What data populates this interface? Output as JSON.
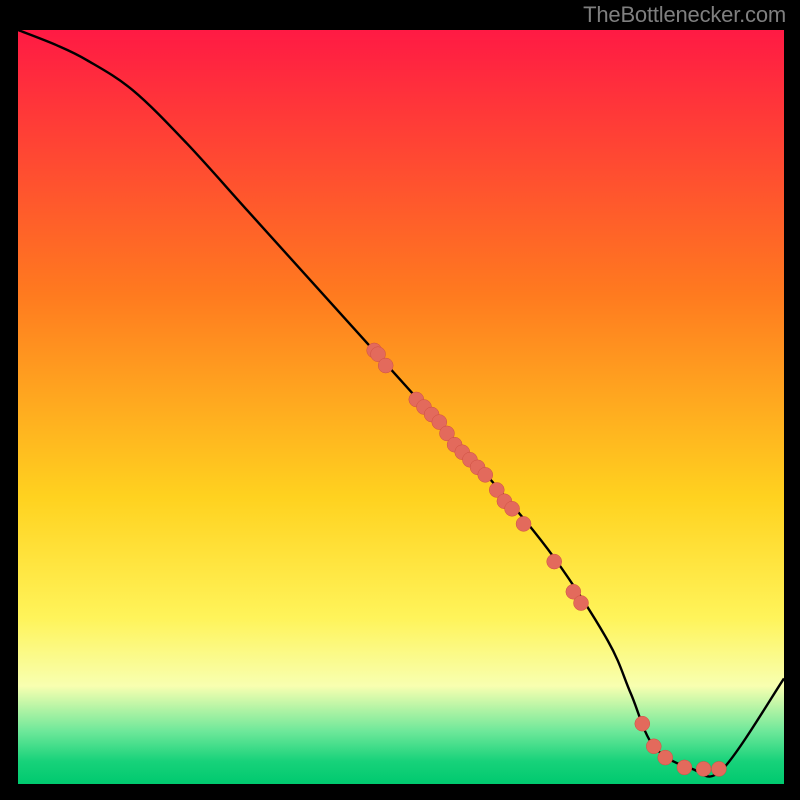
{
  "attribution": "TheBottlenecker.com",
  "colors": {
    "frame": "#000000",
    "attribution_text": "#7f7f7f",
    "line": "#000000",
    "marker_fill": "#e36a5c",
    "marker_stroke": "#cf5042",
    "gradient_top": "#ff1a44",
    "gradient_mid1": "#ff7a1f",
    "gradient_mid2": "#ffd21f",
    "gradient_mid3": "#fff45a",
    "gradient_lightband": "#f8ffb0",
    "gradient_green1": "#6ee89a",
    "gradient_green2": "#17d27a",
    "gradient_bottom": "#00c96f"
  },
  "chart_data": {
    "type": "line",
    "title": "",
    "xlabel": "",
    "ylabel": "",
    "xlim": [
      0,
      100
    ],
    "ylim": [
      0,
      100
    ],
    "series": [
      {
        "name": "curve",
        "x": [
          0,
          5,
          9,
          15,
          22,
          30,
          38,
          46,
          54,
          62,
          70,
          77,
          80,
          83,
          88,
          92,
          100
        ],
        "y": [
          100,
          98,
          96,
          92,
          85,
          76,
          67,
          58,
          49,
          40,
          30,
          19,
          12,
          5,
          2,
          2,
          14
        ]
      }
    ],
    "markers": [
      {
        "x": 46.5,
        "y": 57.5
      },
      {
        "x": 47.0,
        "y": 57.0
      },
      {
        "x": 48.0,
        "y": 55.5
      },
      {
        "x": 52.0,
        "y": 51.0
      },
      {
        "x": 53.0,
        "y": 50.0
      },
      {
        "x": 54.0,
        "y": 49.0
      },
      {
        "x": 55.0,
        "y": 48.0
      },
      {
        "x": 56.0,
        "y": 46.5
      },
      {
        "x": 57.0,
        "y": 45.0
      },
      {
        "x": 58.0,
        "y": 44.0
      },
      {
        "x": 59.0,
        "y": 43.0
      },
      {
        "x": 60.0,
        "y": 42.0
      },
      {
        "x": 61.0,
        "y": 41.0
      },
      {
        "x": 62.5,
        "y": 39.0
      },
      {
        "x": 63.5,
        "y": 37.5
      },
      {
        "x": 64.5,
        "y": 36.5
      },
      {
        "x": 66.0,
        "y": 34.5
      },
      {
        "x": 70.0,
        "y": 29.5
      },
      {
        "x": 72.5,
        "y": 25.5
      },
      {
        "x": 73.5,
        "y": 24.0
      },
      {
        "x": 81.5,
        "y": 8.0
      },
      {
        "x": 83.0,
        "y": 5.0
      },
      {
        "x": 84.5,
        "y": 3.5
      },
      {
        "x": 87.0,
        "y": 2.2
      },
      {
        "x": 89.5,
        "y": 2.0
      },
      {
        "x": 91.5,
        "y": 2.0
      }
    ]
  }
}
